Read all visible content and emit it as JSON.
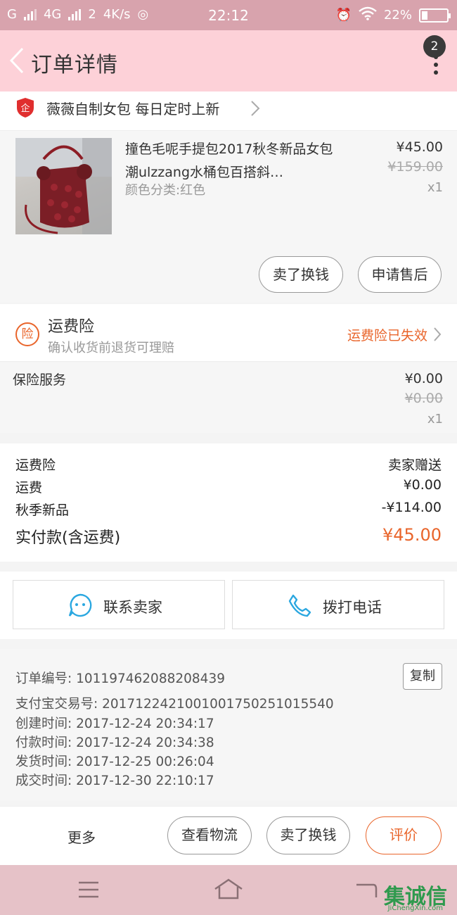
{
  "status_bar": {
    "carrier1": "G",
    "network": "4G",
    "sim_speed": "2",
    "speed": "4K/s",
    "time": "22:12",
    "battery": "22%"
  },
  "header": {
    "title": "订单详情",
    "notification_count": "2"
  },
  "shop": {
    "name": "薇薇自制女包  每日定时上新"
  },
  "product": {
    "title": "撞色毛呢手提包2017秋冬新品女包潮ulzzang水桶包百搭斜…",
    "variant": "颜色分类:红色",
    "price": "¥45.00",
    "original_price": "¥159.00",
    "quantity": "x1",
    "sell_button": "卖了换钱",
    "after_sale_button": "申请售后"
  },
  "insurance": {
    "icon_char": "险",
    "title": "运费险",
    "subtitle": "确认收货前退货可理赔",
    "status": "运费险已失效"
  },
  "service": {
    "label": "保险服务",
    "price": "¥0.00",
    "original_price": "¥0.00",
    "quantity": "x1"
  },
  "fees": [
    {
      "label": "运费险",
      "value": "卖家赠送"
    },
    {
      "label": "运费",
      "value": "¥0.00"
    },
    {
      "label": "秋季新品",
      "value": "-¥114.00"
    }
  ],
  "total": {
    "label": "实付款(含运费)",
    "value": "¥45.00"
  },
  "contact": {
    "seller_button": "联系卖家",
    "call_button": "拨打电话"
  },
  "order_info": {
    "order_no": "订单编号: 101197462088208439",
    "copy_button": "复制",
    "alipay_no": "支付宝交易号: 2017122421001001750251015540",
    "created": "创建时间: 2017-12-24  20:34:17",
    "paid": "付款时间: 2017-12-24  20:34:38",
    "shipped": "发货时间: 2017-12-25  00:26:04",
    "completed": "成交时间: 2017-12-30  22:10:17"
  },
  "actions": {
    "more": "更多",
    "logistics": "查看物流",
    "sell": "卖了换钱",
    "review": "评价"
  },
  "watermark": {
    "text": "集诚信",
    "url": "JiChengXin.com"
  },
  "colors": {
    "accent": "#e9652b",
    "header_bg": "#fdd1d8",
    "status_bg": "#d8a3ad"
  }
}
